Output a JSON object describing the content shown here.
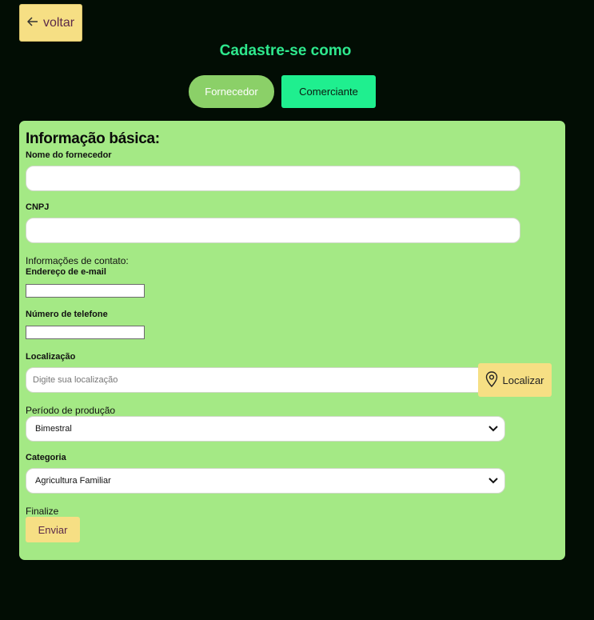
{
  "header": {
    "back_label": "voltar",
    "title": "Cadastre-se como",
    "tabs": [
      {
        "label": "Fornecedor"
      },
      {
        "label": "Comerciante"
      }
    ]
  },
  "form": {
    "heading": "Informação básica:",
    "supplier_name_label": "Nome do fornecedor",
    "cnpj_label": "CNPJ",
    "contact_section_label": "Informações de contato:",
    "email_label": "Endereço de e-mail",
    "phone_label": "Número de telefone",
    "location_label": "Localização",
    "location_placeholder": "Digite sua localização",
    "locate_button_label": "Localizar",
    "production_period_label": "Período de produção",
    "production_period_value": "Bimestral",
    "category_label": "Categoria",
    "category_value": "Agricultura Familiar",
    "finalize_label": "Finalize",
    "submit_label": "Enviar"
  },
  "colors": {
    "background": "#020d04",
    "title": "#2ee88d",
    "card": "#a4e985",
    "button_yellow": "#f6df84",
    "tab_active": "#8bd068",
    "tab_inactive": "#1fef8f"
  }
}
